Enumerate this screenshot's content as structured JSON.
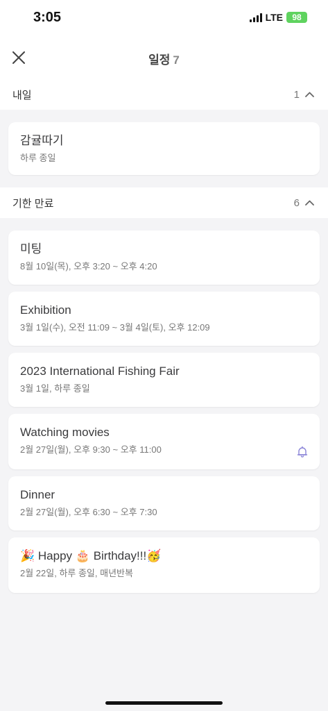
{
  "status": {
    "time": "3:05",
    "network": "LTE",
    "battery": "98"
  },
  "nav": {
    "title": "일정",
    "count": "7"
  },
  "sections": {
    "tomorrow": {
      "label": "내일",
      "count": "1",
      "items": [
        {
          "title": "감귤따기",
          "sub": "하루 종일"
        }
      ]
    },
    "overdue": {
      "label": "기한 만료",
      "count": "6",
      "items": [
        {
          "title": "미팅",
          "sub": "8월 10일(목), 오후 3:20 ~ 오후 4:20"
        },
        {
          "title": "Exhibition",
          "sub": "3월 1일(수), 오전 11:09 ~ 3월 4일(토), 오후 12:09"
        },
        {
          "title": "2023 International Fishing Fair",
          "sub": "3월 1일, 하루 종일"
        },
        {
          "title": "Watching movies",
          "sub": "2월 27일(월), 오후 9:30 ~ 오후 11:00",
          "icon": "bell-icon"
        },
        {
          "title": "Dinner",
          "sub": "2월 27일(월), 오후 6:30 ~ 오후 7:30"
        },
        {
          "title_emoji_1": "🎉",
          "title_word_1": "Happy",
          "title_emoji_2": "🎂",
          "title_word_2": "Birthday!!!",
          "title_emoji_3": "🥳",
          "sub": "2월 22일, 하루 종일, 매년반복"
        }
      ]
    }
  },
  "colors": {
    "bell": "#8a84d8",
    "battery": "#5fd35f"
  }
}
